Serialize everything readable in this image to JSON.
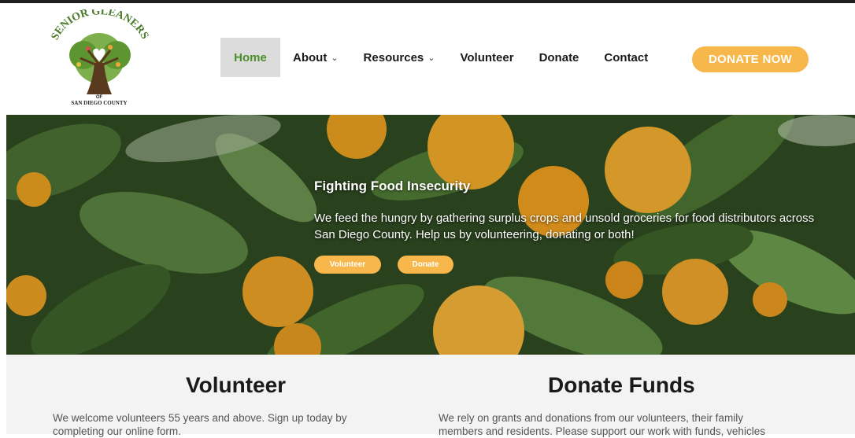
{
  "logo": {
    "arc_text": "SENIOR GLEANERS",
    "small_text": "OF",
    "bottom_text": "SAN DIEGO COUNTY"
  },
  "nav": {
    "items": [
      {
        "label": "Home",
        "active": true
      },
      {
        "label": "About",
        "dropdown": true
      },
      {
        "label": "Resources",
        "dropdown": true
      },
      {
        "label": "Volunteer"
      },
      {
        "label": "Donate"
      },
      {
        "label": "Contact"
      }
    ],
    "donate_now": "DONATE NOW"
  },
  "hero": {
    "title": "Fighting Food Insecurity",
    "text": "We feed the hungry by gathering surplus crops and unsold groceries for food distributors across San Diego County. Help us by volunteering, donating or both!",
    "buttons": [
      "Volunteer",
      "Donate"
    ]
  },
  "volunteer": {
    "title": "Volunteer",
    "text": "We welcome volunteers 55 years and above. Sign up today by completing our online form."
  },
  "donate_funds": {
    "title": "Donate Funds",
    "text": "We rely on grants and donations from our volunteers, their family members and residents. Please support our work with funds, vehicles"
  },
  "colors": {
    "accent": "#f7b74a",
    "active_nav": "#4a8f2a",
    "active_bg": "#dcdcdc",
    "section_bg": "#f3f3f3"
  }
}
